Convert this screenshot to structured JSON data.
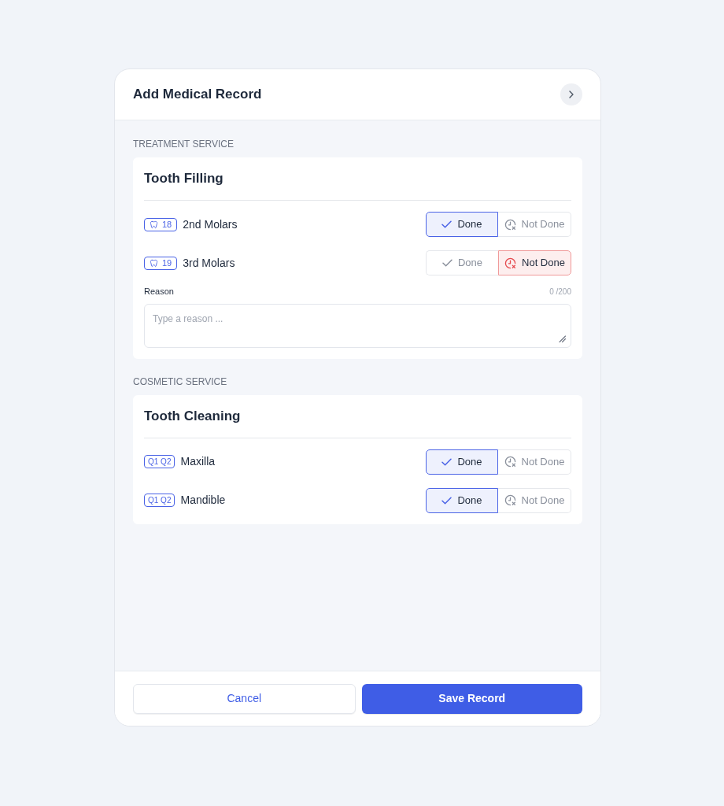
{
  "header": {
    "title": "Add Medical Record"
  },
  "sections": [
    {
      "label": "TREATMENT SERVICE",
      "service": {
        "title": "Tooth Filling",
        "items": [
          {
            "badge": {
              "kind": "tooth",
              "text": "18"
            },
            "name": "2nd Molars",
            "options": [
              {
                "kind": "done",
                "label": "Done",
                "selected": true
              },
              {
                "kind": "not_done",
                "label": "Not Done",
                "selected": false
              }
            ]
          },
          {
            "badge": {
              "kind": "tooth",
              "text": "19"
            },
            "name": "3rd Molars",
            "options": [
              {
                "kind": "done",
                "label": "Done",
                "selected": false
              },
              {
                "kind": "not_done",
                "label": "Not Done",
                "selected": true
              }
            ],
            "reason": {
              "label": "Reason",
              "counter": "0 /200",
              "placeholder": "Type a reason ..."
            }
          }
        ]
      }
    },
    {
      "label": "COSMETIC SERVICE",
      "service": {
        "title": "Tooth Cleaning",
        "items": [
          {
            "badge": {
              "kind": "quadrants",
              "text": "Q1 Q2"
            },
            "name": "Maxilla",
            "options": [
              {
                "kind": "done",
                "label": "Done",
                "selected": true
              },
              {
                "kind": "not_done",
                "label": "Not Done",
                "selected": false
              }
            ]
          },
          {
            "badge": {
              "kind": "quadrants",
              "text": "Q1 Q2"
            },
            "name": "Mandible",
            "options": [
              {
                "kind": "done",
                "label": "Done",
                "selected": true
              },
              {
                "kind": "not_done",
                "label": "Not Done",
                "selected": false
              }
            ]
          }
        ]
      }
    }
  ],
  "footer": {
    "buttons": [
      {
        "kind": "secondary",
        "label": "Cancel"
      },
      {
        "kind": "primary",
        "label": "Save Record"
      }
    ]
  }
}
